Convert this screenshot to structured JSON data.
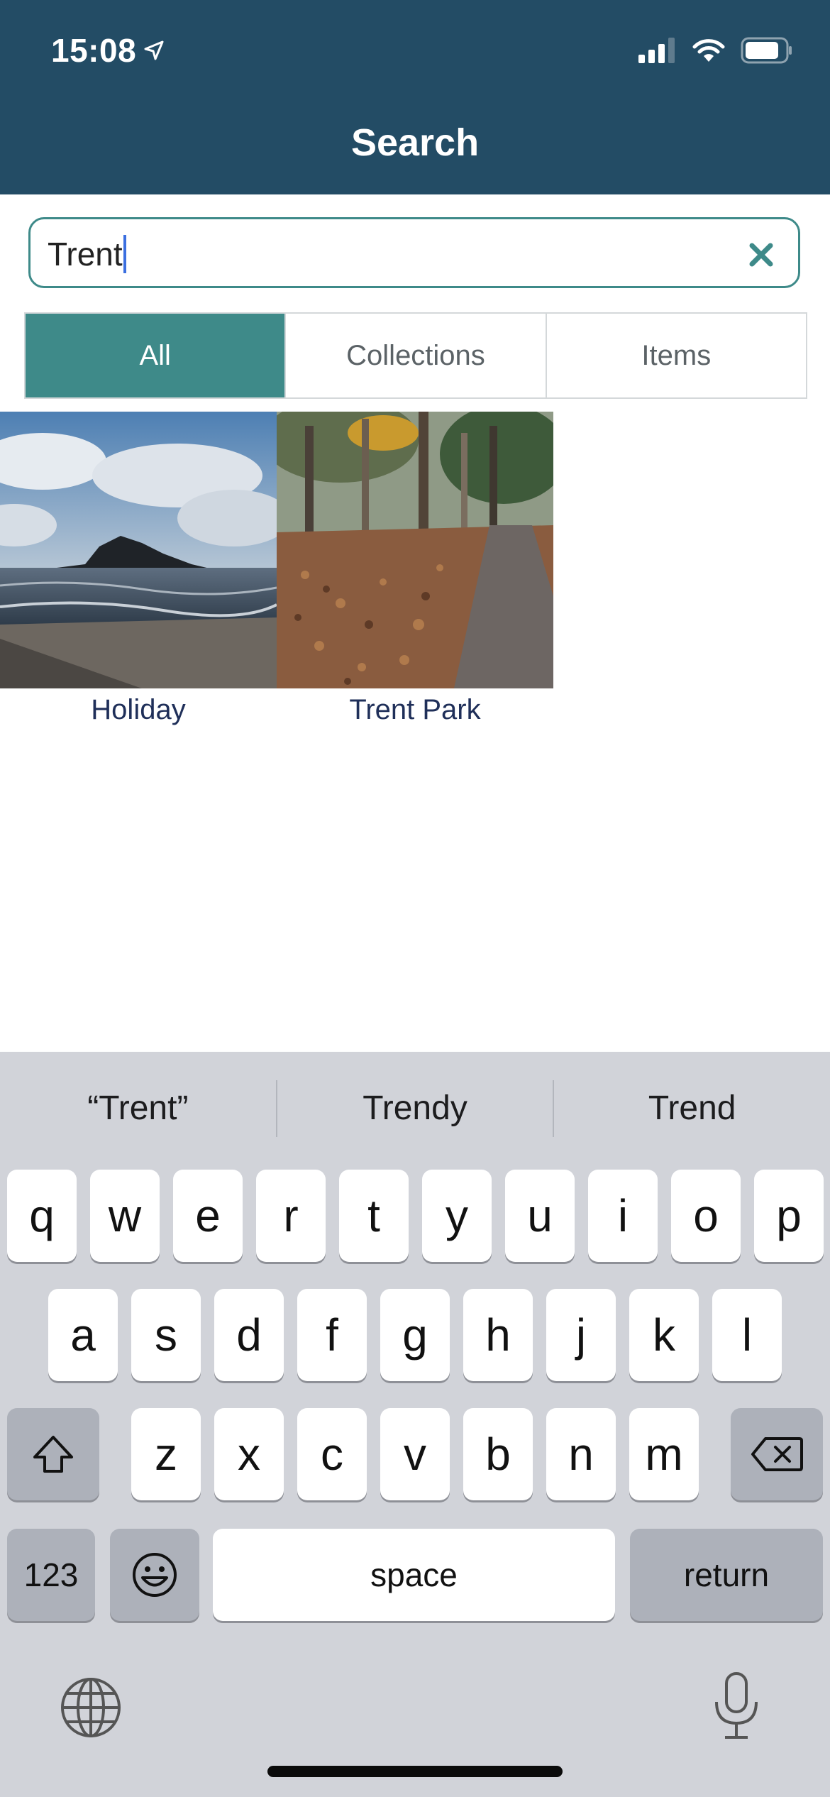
{
  "status": {
    "time": "15:08"
  },
  "header": {
    "title": "Search"
  },
  "search": {
    "value": "Trent"
  },
  "tabs": [
    {
      "label": "All",
      "active": true
    },
    {
      "label": "Collections",
      "active": false
    },
    {
      "label": "Items",
      "active": false
    }
  ],
  "results": [
    {
      "label": "Holiday"
    },
    {
      "label": "Trent Park"
    }
  ],
  "keyboard": {
    "suggestions": [
      "“Trent”",
      "Trendy",
      "Trend"
    ],
    "row1": [
      "q",
      "w",
      "e",
      "r",
      "t",
      "y",
      "u",
      "i",
      "o",
      "p"
    ],
    "row2": [
      "a",
      "s",
      "d",
      "f",
      "g",
      "h",
      "j",
      "k",
      "l"
    ],
    "row3": [
      "z",
      "x",
      "c",
      "v",
      "b",
      "n",
      "m"
    ],
    "numbers_label": "123",
    "space_label": "space",
    "return_label": "return"
  },
  "colors": {
    "header": "#234c65",
    "accent": "#3e8a89",
    "link": "#1f2f59",
    "keyboard": "#d1d3d9"
  }
}
